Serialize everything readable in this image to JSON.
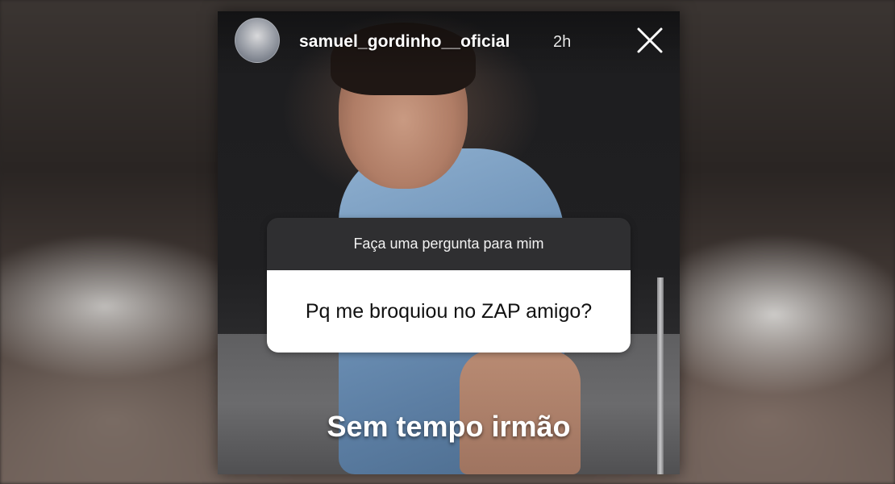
{
  "story": {
    "author": {
      "username": "samuel_gordinho__oficial",
      "time_ago": "2h"
    },
    "close_icon": "close-icon",
    "question_sticker": {
      "prompt": "Faça uma pergunta para mim",
      "answer": "Pq me broquiou no ZAP amigo?"
    },
    "caption": "Sem tempo irmão"
  },
  "colors": {
    "sticker_header_bg": "#2f2f31",
    "sticker_body_bg": "#ffffff",
    "text_on_dark": "#ffffff"
  }
}
